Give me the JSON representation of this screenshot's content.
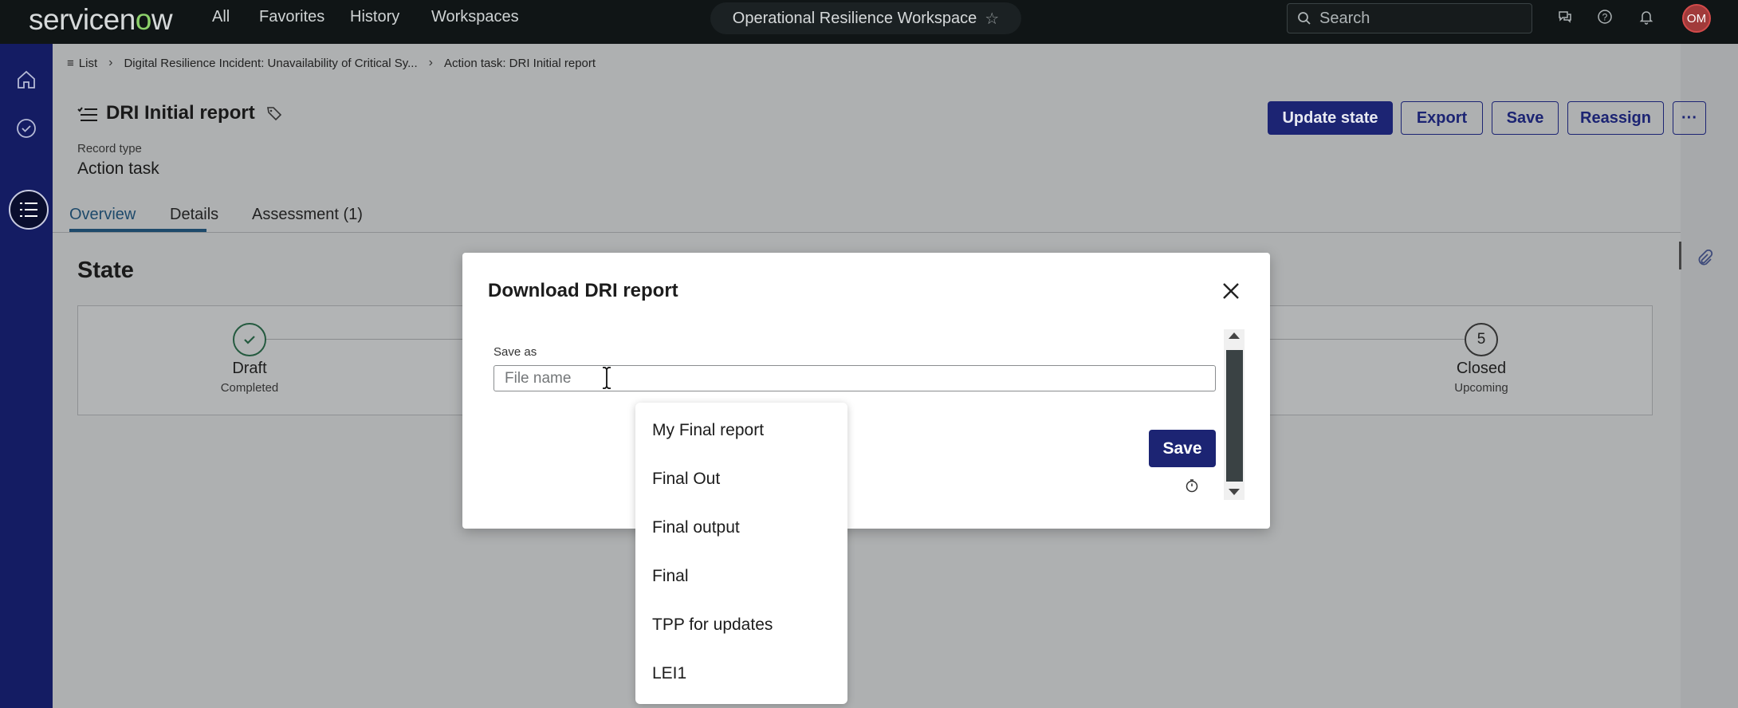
{
  "topbar": {
    "logo_main": "servicen",
    "logo_o": "o",
    "logo_end": "w",
    "nav": [
      "All",
      "Favorites",
      "History",
      "Workspaces"
    ],
    "workspace": "Operational Resilience Workspace",
    "search_placeholder": "Search",
    "avatar_initials": "OM"
  },
  "breadcrumb": {
    "list": "List",
    "incident": "Digital Resilience Incident: Unavailability of Critical Sy...",
    "current": "Action task: DRI Initial report"
  },
  "record": {
    "title": "DRI Initial report",
    "type_label": "Record type",
    "type_value": "Action task"
  },
  "actions": {
    "update_state": "Update state",
    "export": "Export",
    "save": "Save",
    "reassign": "Reassign",
    "more": "···"
  },
  "tabs": [
    "Overview",
    "Details",
    "Assessment (1)"
  ],
  "state": {
    "title": "State",
    "steps": [
      {
        "name": "Draft",
        "status": "Completed"
      },
      {
        "number": "5",
        "name": "Closed",
        "status": "Upcoming"
      }
    ]
  },
  "modal": {
    "title": "Download DRI report",
    "save_as_label": "Save as",
    "file_placeholder": "File name",
    "save_button": "Save"
  },
  "suggestions": [
    "My Final report",
    "Final Out",
    "Final output",
    "Final",
    "TPP for updates",
    "LEI1"
  ],
  "colors": {
    "primary": "#1c2473",
    "rail": "#141c63",
    "topbar": "#101516",
    "success": "#245a3f"
  }
}
